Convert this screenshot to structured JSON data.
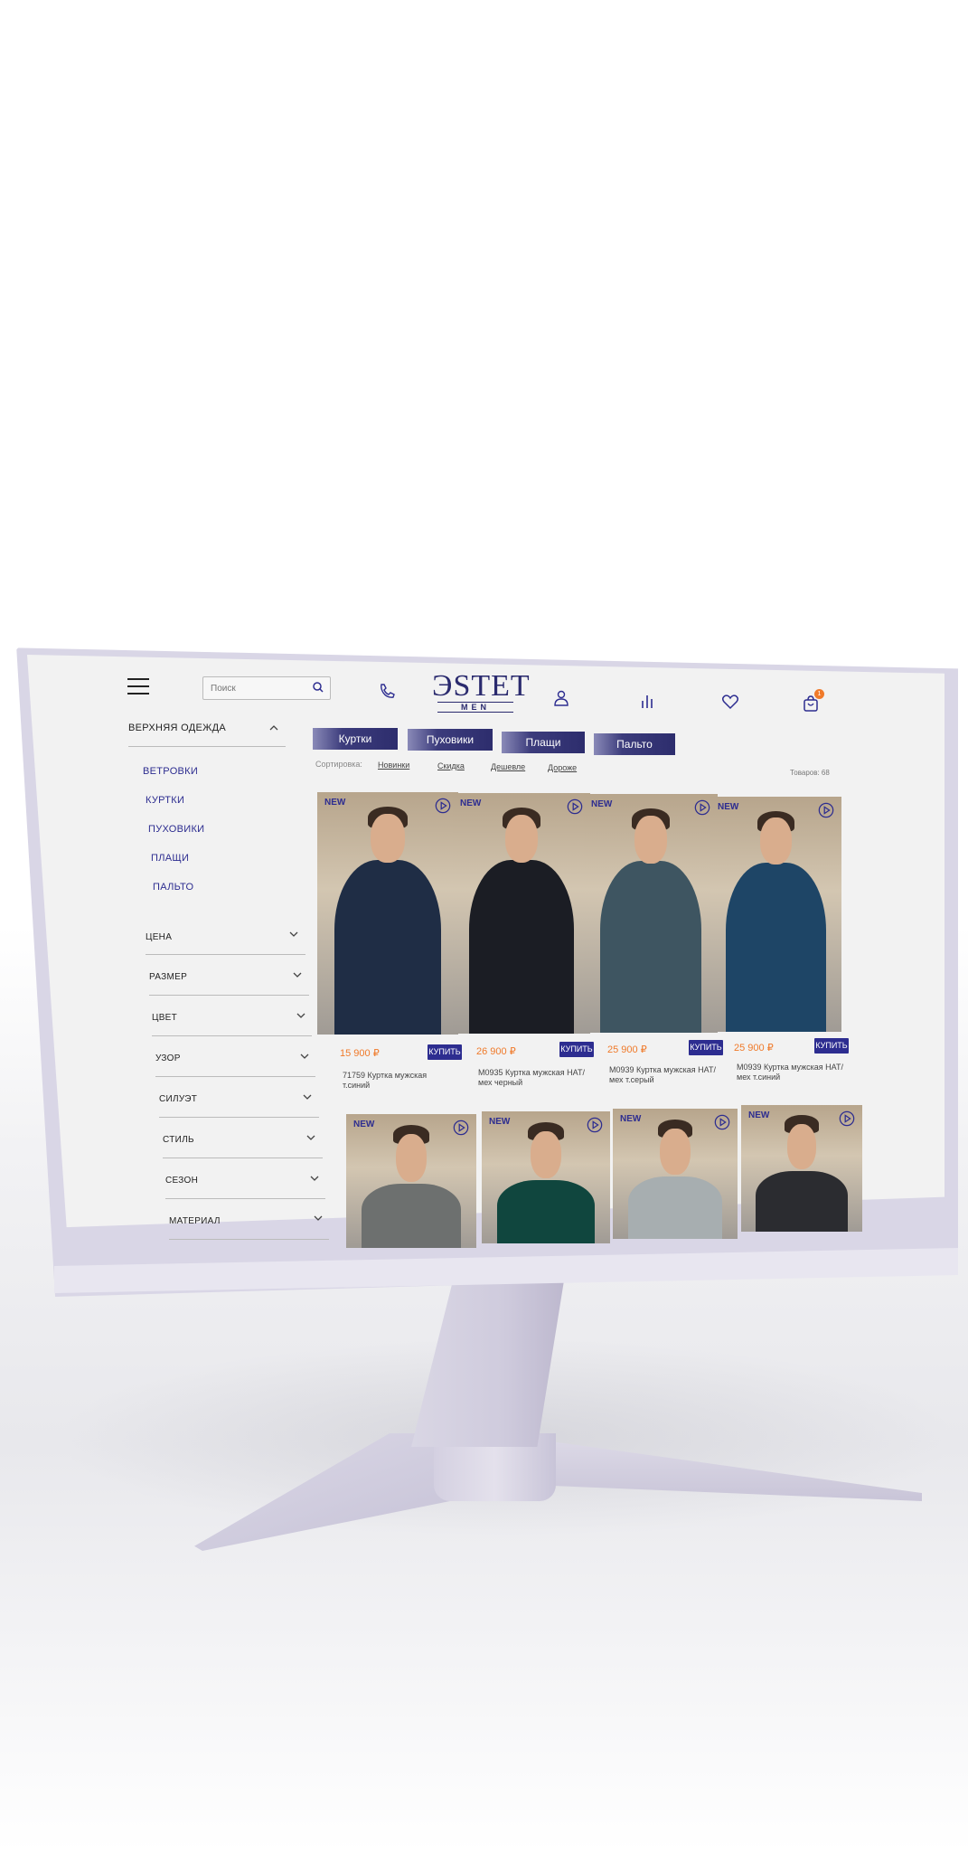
{
  "header": {
    "search_placeholder": "Поиск",
    "logo_main": "ЭSTET",
    "logo_sub": "MEN",
    "cart_count": "1"
  },
  "sidebar": {
    "title": "ВЕРХНЯЯ ОДЕЖДА",
    "categories": [
      "ВЕТРОВКИ",
      "КУРТКИ",
      "ПУХОВИКИ",
      "ПЛАЩИ",
      "ПАЛЬТО"
    ],
    "filters": [
      "ЦЕНА",
      "РАЗМЕР",
      "ЦВЕТ",
      "УЗОР",
      "СИЛУЭТ",
      "СТИЛЬ",
      "СЕЗОН",
      "МАТЕРИАЛ"
    ]
  },
  "tabs": [
    "Куртки",
    "Пуховики",
    "Плащи",
    "Пальто"
  ],
  "sort": {
    "label": "Сортировка:",
    "options": [
      "Новинки",
      "Скидка",
      "Дешевле",
      "Дороже"
    ],
    "count": "Товаров: 68"
  },
  "products": [
    {
      "badge": "NEW",
      "price": "15 900 ₽",
      "buy": "КУПИТЬ",
      "name_line1": "71759 Куртка мужская",
      "name_line2": "т.синий",
      "coat_color": "#1f2d45"
    },
    {
      "badge": "NEW",
      "price": "26 900 ₽",
      "buy": "КУПИТЬ",
      "name_line1": "M0935 Куртка мужская HAT/",
      "name_line2": "мех черный",
      "coat_color": "#1b1d24"
    },
    {
      "badge": "NEW",
      "price": "25 900 ₽",
      "buy": "КУПИТЬ",
      "name_line1": "M0939 Куртка мужская HAT/",
      "name_line2": "мех т.серый",
      "coat_color": "#3e5561"
    },
    {
      "badge": "NEW",
      "price": "25 900 ₽",
      "buy": "КУПИТЬ",
      "name_line1": "M0939 Куртка мужская HAT/",
      "name_line2": "мех т.синий",
      "coat_color": "#1e4566"
    }
  ],
  "products_row2": [
    {
      "badge": "NEW",
      "coat_color": "#6d706f"
    },
    {
      "badge": "NEW",
      "coat_color": "#10463e"
    },
    {
      "badge": "NEW",
      "coat_color": "#a7aeb0"
    },
    {
      "badge": "NEW",
      "coat_color": "#2b2c30"
    }
  ]
}
